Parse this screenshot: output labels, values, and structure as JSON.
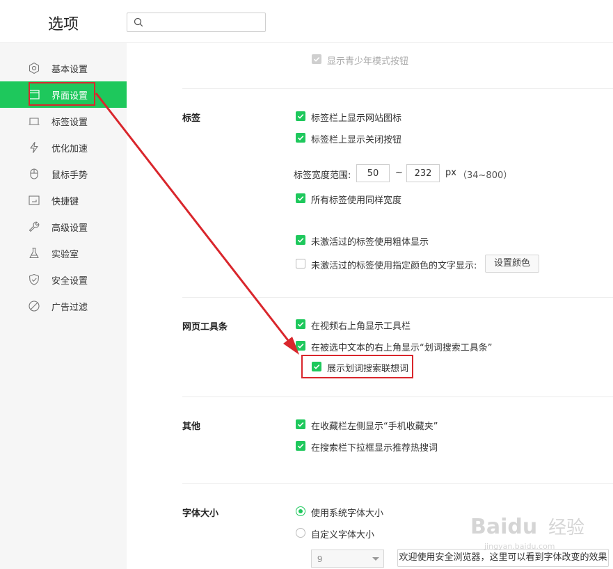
{
  "header": {
    "title": "选项",
    "search_placeholder": ""
  },
  "sidebar": {
    "items": [
      {
        "label": "基本设置",
        "icon": "gear-icon"
      },
      {
        "label": "界面设置",
        "icon": "window-icon",
        "active": true
      },
      {
        "label": "标签设置",
        "icon": "tab-icon"
      },
      {
        "label": "优化加速",
        "icon": "lightning-icon"
      },
      {
        "label": "鼠标手势",
        "icon": "mouse-icon"
      },
      {
        "label": "快捷键",
        "icon": "keyboard-icon"
      },
      {
        "label": "高级设置",
        "icon": "wrench-icon"
      },
      {
        "label": "实验室",
        "icon": "flask-icon"
      },
      {
        "label": "安全设置",
        "icon": "shield-icon"
      },
      {
        "label": "广告过滤",
        "icon": "block-icon"
      }
    ]
  },
  "top_option": {
    "label": "显示青少年模式按钮"
  },
  "tabs_section": {
    "title": "标签",
    "show_site_icon": "标签栏上显示网站图标",
    "show_close_button": "标签栏上显示关闭按钮",
    "width_range_label": "标签宽度范围:",
    "width_min": "50",
    "range_sep": "~",
    "width_max": "232",
    "unit": "px",
    "range_hint": "（34~800）",
    "same_width": "所有标签使用同样宽度",
    "bold_inactive": "未激活过的标签使用粗体显示",
    "color_inactive": "未激活过的标签使用指定颜色的文字显示:",
    "set_color_button": "设置颜色"
  },
  "toolbar_section": {
    "title": "网页工具条",
    "video_toolbar": "在视频右上角显示工具栏",
    "selection_toolbar": "在被选中文本的右上角显示“划词搜索工具条”",
    "show_suggestions": "展示划词搜索联想词"
  },
  "other_section": {
    "title": "其他",
    "mobile_favorites": "在收藏栏左侧显示“手机收藏夹”",
    "hot_search": "在搜索栏下拉框显示推荐热搜词"
  },
  "font_section": {
    "title": "字体大小",
    "system_font": "使用系统字体大小",
    "custom_font": "自定义字体大小",
    "font_size_value": "9",
    "preview_text": "欢迎使用安全浏览器，这里可以看到字体改变的效果"
  },
  "colors": {
    "accent": "#1ec85c",
    "highlight": "#d9262c"
  },
  "watermark": {
    "brand": "Baidu",
    "suffix": "经验",
    "sub": "jingyan.baidu.com"
  }
}
